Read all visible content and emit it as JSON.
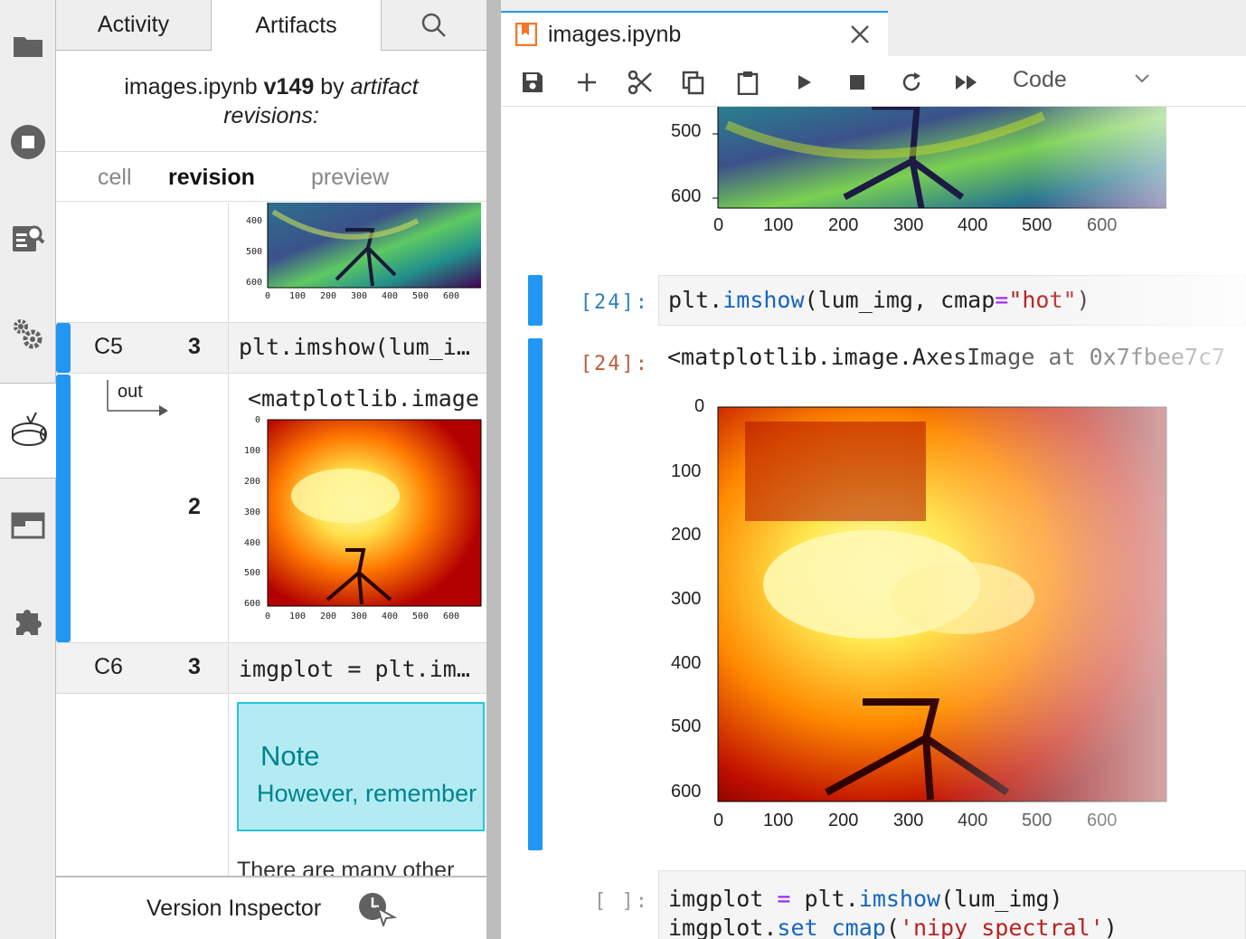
{
  "left_panel": {
    "tabs": [
      {
        "label": "Activity"
      },
      {
        "label": "Artifacts"
      }
    ],
    "title": {
      "name": "images.ipynb",
      "version": "v149",
      "by": "by",
      "suffix": "artifact revisions:"
    },
    "columns": {
      "cell": "cell",
      "revision": "revision",
      "preview": "preview"
    },
    "rows": [
      {
        "cell": "C5",
        "revision": "3",
        "preview": "plt.imshow(lum_i…"
      },
      {
        "revision": "2",
        "preview": "<matplotlib.image"
      },
      {
        "cell": "C6",
        "revision": "3",
        "preview": "imgplot = plt.im…"
      }
    ],
    "out_label": "out",
    "note": {
      "title": "Note",
      "body": "However, remember"
    },
    "cut_text": "There are many other",
    "small_axis": {
      "ticks_y_top": [
        "400",
        "500",
        "600"
      ],
      "ticks_x": [
        "0",
        "100",
        "200",
        "300",
        "400",
        "500",
        "600"
      ],
      "ticks_y_hot": [
        "0",
        "100",
        "200",
        "300",
        "400",
        "500",
        "600"
      ]
    },
    "inspector_label": "Version Inspector"
  },
  "notebook": {
    "tab_title": "images.ipynb",
    "cell_type": "Code",
    "top_axis": {
      "y_ticks": [
        "500",
        "600"
      ],
      "x_ticks": [
        "0",
        "100",
        "200",
        "300",
        "400",
        "500",
        "600"
      ]
    },
    "cell24": {
      "in_prompt": "[24]:",
      "code": {
        "a": "plt",
        "b": ".",
        "c": "imshow",
        "d": "(lum_img, cmap",
        "e": "=",
        "f": "\"hot\"",
        "g": ")"
      },
      "out_prompt": "[24]:",
      "out_text": "<matplotlib.image.AxesImage at 0x7fbee7c7"
    },
    "hot_axis": {
      "y_ticks": [
        "0",
        "100",
        "200",
        "300",
        "400",
        "500",
        "600"
      ],
      "x_ticks": [
        "0",
        "100",
        "200",
        "300",
        "400",
        "500",
        "600"
      ]
    },
    "next_cell": {
      "prompt": "[ ]:",
      "line1": {
        "a": "imgplot ",
        "b": "=",
        "c": " plt",
        "d": ".",
        "e": "imshow",
        "f": "(lum_img)"
      },
      "line2": {
        "a": "imgplot",
        "b": ".",
        "c": "set_cmap",
        "d": "(",
        "e": "'nipy_spectral'",
        "f": ")"
      }
    }
  }
}
